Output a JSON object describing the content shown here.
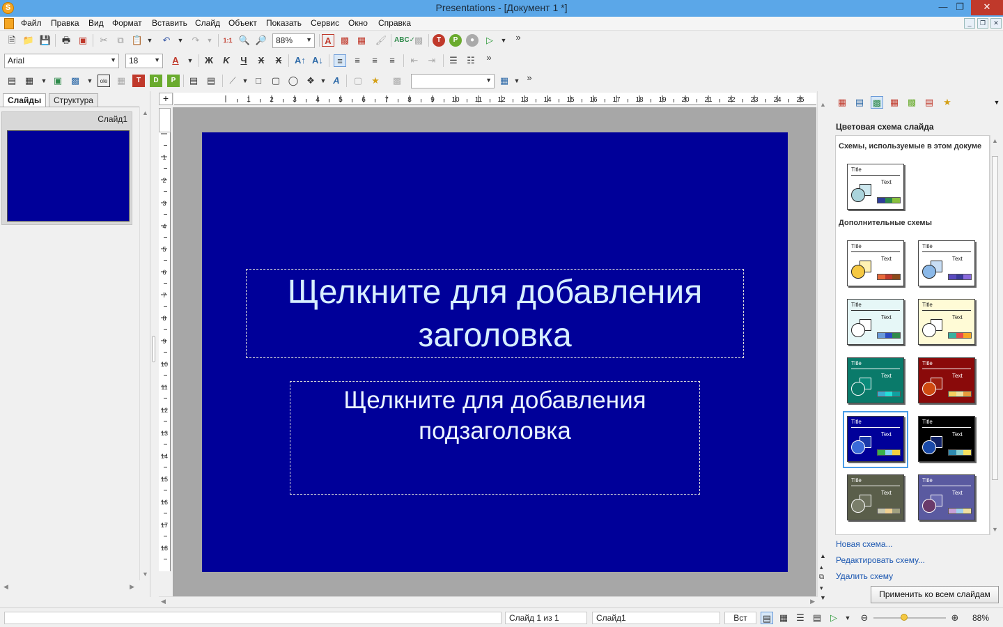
{
  "window": {
    "title": "Presentations - [Документ 1 *]"
  },
  "menu": [
    "Файл",
    "Правка",
    "Вид",
    "Формат",
    "Вставить",
    "Слайд",
    "Объект",
    "Показать",
    "Сервис",
    "Окно",
    "Справка"
  ],
  "toolbar": {
    "zoom_value": "88%",
    "font_name": "Arial",
    "font_size": "18",
    "overflow": "»"
  },
  "left_panel": {
    "tabs": [
      "Слайды",
      "Структура"
    ],
    "slide_label": "Слайд1"
  },
  "ruler": {
    "h_numbers": [
      "1",
      "2",
      "3",
      "4",
      "5",
      "6",
      "7",
      "8",
      "9",
      "10",
      "11",
      "12",
      "13",
      "14",
      "15",
      "16",
      "17",
      "18",
      "19",
      "20",
      "21",
      "22",
      "23",
      "24",
      "25"
    ],
    "v_numbers": [
      "1",
      "2",
      "3",
      "4",
      "5",
      "6",
      "7",
      "8",
      "9",
      "10",
      "11",
      "12",
      "13",
      "14",
      "15",
      "16",
      "17",
      "18"
    ]
  },
  "slide": {
    "background": "#000099",
    "title_placeholder": "Щелкните для добавления заголовка",
    "subtitle_placeholder": "Щелкните для добавления подзаголовка"
  },
  "right_panel": {
    "title": "Цветовая схема слайда",
    "section_used": "Схемы, используемые в этом докуме",
    "section_additional": "Дополнительные схемы",
    "scheme_title": "Title",
    "scheme_text": "Text",
    "links": [
      "Новая схема...",
      "Редактировать схему...",
      "Удалить схему"
    ],
    "apply_button": "Применить ко всем слайдам"
  },
  "schemes": [
    {
      "bg": "#ffffff",
      "fg": "#222222",
      "circle": "#aad4dc",
      "square": "#cde8ef",
      "bars": [
        "#2e3d99",
        "#2e8a4a",
        "#88c03e"
      ],
      "selected": false
    },
    {
      "bg": "#ffffff",
      "fg": "#222222",
      "circle": "#f5c842",
      "square": "#fff1b3",
      "bars": [
        "#e86a3a",
        "#c0392b",
        "#8e4a1a"
      ],
      "selected": false
    },
    {
      "bg": "#ffffff",
      "fg": "#222222",
      "circle": "#8ab8e8",
      "square": "#c8def5",
      "bars": [
        "#5a4abf",
        "#3a3a9a",
        "#8a6add"
      ],
      "selected": false
    },
    {
      "bg": "#e6f7f7",
      "fg": "#222222",
      "circle": "#ffffff",
      "square": "#ffffff",
      "bars": [
        "#6a9ad8",
        "#2a4ac0",
        "#2e8a4a"
      ],
      "selected": false
    },
    {
      "bg": "#fffbd6",
      "fg": "#222222",
      "circle": "#ffffff",
      "square": "#ffffff",
      "bars": [
        "#3ab0a0",
        "#e84a4a",
        "#f5a623"
      ],
      "selected": false
    },
    {
      "bg": "#0a7a6a",
      "fg": "#ffffff",
      "circle": "#0a7a6a",
      "square": "#0a8a7a",
      "bars": [
        "#3ab0d0",
        "#22e0d8",
        "#10a0a0"
      ],
      "selected": false
    },
    {
      "bg": "#8a0a0a",
      "fg": "#ffffff",
      "circle": "#d04a10",
      "square": "#a02010",
      "bars": [
        "#f5d060",
        "#f0e0a0",
        "#e89a3a"
      ],
      "selected": false
    },
    {
      "bg": "#000099",
      "fg": "#ffffff",
      "circle": "#3a6ad8",
      "square": "#1a3aaa",
      "bars": [
        "#3ab04a",
        "#8ad0f5",
        "#f5d040"
      ],
      "selected": true
    },
    {
      "bg": "#000000",
      "fg": "#ffffff",
      "circle": "#1a4aa8",
      "square": "#112266",
      "bars": [
        "#2e8ab0",
        "#8ad0d0",
        "#f5e060"
      ],
      "selected": false
    },
    {
      "bg": "#5a5e4a",
      "fg": "#ffffff",
      "circle": "#7a7e6a",
      "square": "#6a6e5a",
      "bars": [
        "#c8c8b0",
        "#f0d090",
        "#a0a080"
      ],
      "selected": false
    },
    {
      "bg": "#5a5aa0",
      "fg": "#ffffff",
      "circle": "#6a3a6a",
      "square": "#6a6ab0",
      "bars": [
        "#c8a0d8",
        "#a0d0f0",
        "#f0e0a0"
      ],
      "selected": false
    }
  ],
  "status": {
    "slide_count": "Слайд 1 из 1",
    "slide_name": "Слайд1",
    "mode": "Вст",
    "zoom": "88%"
  }
}
